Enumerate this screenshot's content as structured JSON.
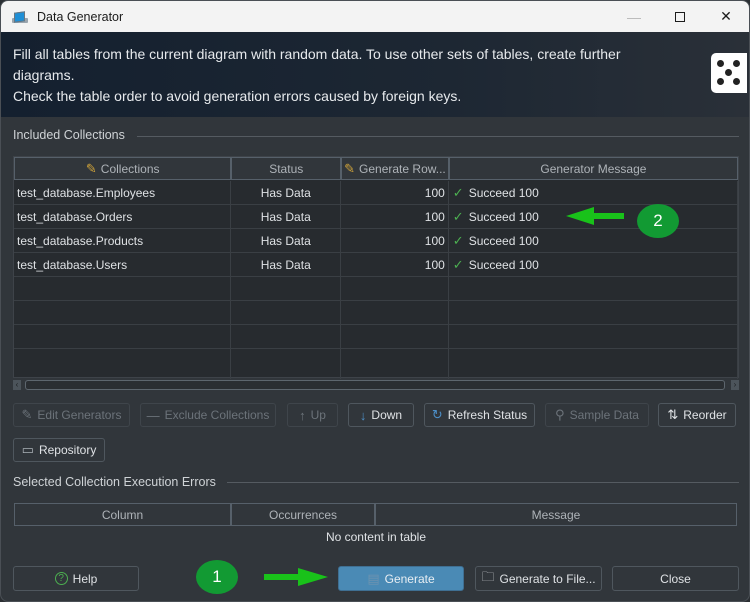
{
  "window": {
    "title": "Data Generator",
    "controls": {
      "minimize": "—",
      "maximize": "□",
      "close": "✕"
    }
  },
  "banner": {
    "lines": [
      "Fill all tables from the current diagram with random data. To use other sets of tables, create further",
      "diagrams.",
      "Check the table order to avoid generation errors caused by foreign keys."
    ],
    "icon": "dice-icon"
  },
  "included": {
    "group_label": "Included Collections",
    "columns": [
      "Collections",
      "Status",
      "Generate Row...",
      "Generator Message"
    ],
    "rows": [
      {
        "collection": "test_database.Employees",
        "status": "Has Data",
        "rows": "100",
        "message": "Succeed 100"
      },
      {
        "collection": "test_database.Orders",
        "status": "Has Data",
        "rows": "100",
        "message": "Succeed 100"
      },
      {
        "collection": "test_database.Products",
        "status": "Has Data",
        "rows": "100",
        "message": "Succeed 100"
      },
      {
        "collection": "test_database.Users",
        "status": "Has Data",
        "rows": "100",
        "message": "Succeed 100"
      }
    ]
  },
  "toolbar": {
    "edit_generators": "Edit Generators",
    "exclude_collections": "Exclude Collections",
    "up": "Up",
    "down": "Down",
    "refresh_status": "Refresh Status",
    "sample_data": "Sample Data",
    "reorder": "Reorder",
    "repository": "Repository"
  },
  "errors": {
    "group_label": "Selected Collection Execution Errors",
    "columns": [
      "Column",
      "Occurrences",
      "Message"
    ],
    "empty_text": "No content in table"
  },
  "footer": {
    "help": "Help",
    "generate": "Generate",
    "generate_to_file": "Generate to File...",
    "close": "Close"
  },
  "annotations": {
    "badge1": "1",
    "badge2": "2",
    "color": "#129a33",
    "arrow_color": "#19c21a"
  }
}
